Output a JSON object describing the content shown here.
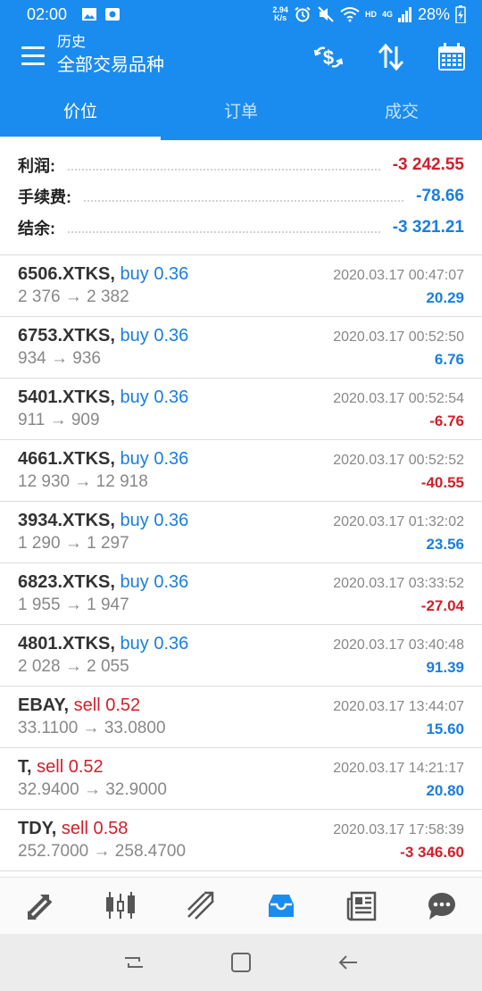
{
  "status": {
    "time": "02:00",
    "speed_top": "2.94",
    "speed_bottom": "K/s",
    "hd": "HD",
    "net": "4G",
    "battery": "28%"
  },
  "header": {
    "subtitle": "历史",
    "title": "全部交易品种"
  },
  "tabs": [
    {
      "label": "价位"
    },
    {
      "label": "订单"
    },
    {
      "label": "成交"
    }
  ],
  "summary": {
    "profit_label": "利润:",
    "profit_value": "-3 242.55",
    "fee_label": "手续费:",
    "fee_value": "-78.66",
    "balance_label": "结余:",
    "balance_value": "-3 321.21"
  },
  "trades": [
    {
      "symbol": "6506.XTKS,",
      "side": "buy 0.36",
      "prices": "2 376 → 2 382",
      "date": "2020.03.17 00:47:07",
      "profit": "20.29"
    },
    {
      "symbol": "6753.XTKS,",
      "side": "buy 0.36",
      "prices": "934 → 936",
      "date": "2020.03.17 00:52:50",
      "profit": "6.76"
    },
    {
      "symbol": "5401.XTKS,",
      "side": "buy 0.36",
      "prices": "911 → 909",
      "date": "2020.03.17 00:52:54",
      "profit": "-6.76"
    },
    {
      "symbol": "4661.XTKS,",
      "side": "buy 0.36",
      "prices": "12 930 → 12 918",
      "date": "2020.03.17 00:52:52",
      "profit": "-40.55"
    },
    {
      "symbol": "3934.XTKS,",
      "side": "buy 0.36",
      "prices": "1 290 → 1 297",
      "date": "2020.03.17 01:32:02",
      "profit": "23.56"
    },
    {
      "symbol": "6823.XTKS,",
      "side": "buy 0.36",
      "prices": "1 955 → 1 947",
      "date": "2020.03.17 03:33:52",
      "profit": "-27.04"
    },
    {
      "symbol": "4801.XTKS,",
      "side": "buy 0.36",
      "prices": "2 028 → 2 055",
      "date": "2020.03.17 03:40:48",
      "profit": "91.39"
    },
    {
      "symbol": "EBAY,",
      "side": "sell 0.52",
      "prices": "33.1100 → 33.0800",
      "date": "2020.03.17 13:44:07",
      "profit": "15.60"
    },
    {
      "symbol": "T,",
      "side": "sell 0.52",
      "prices": "32.9400 → 32.9000",
      "date": "2020.03.17 14:21:17",
      "profit": "20.80"
    },
    {
      "symbol": "TDY,",
      "side": "sell 0.58",
      "prices": "252.7000 → 258.4700",
      "date": "2020.03.17 17:58:39",
      "profit": "-3 346.60"
    }
  ],
  "colors": {
    "brand": "#1a8cf0",
    "buy": "#1a7ee0",
    "sell": "#d0202a",
    "positive": "#1a7ee0",
    "negative": "#d0202a"
  },
  "icons": {
    "appbar": [
      "currency-exchange-icon",
      "sort-icon",
      "calendar-icon"
    ],
    "bottom_nav": [
      "quotes-icon",
      "chart-icon",
      "trade-icon",
      "history-icon",
      "news-icon",
      "chat-icon"
    ],
    "active_nav": "history-icon",
    "system_nav": [
      "recent-apps-icon",
      "home-icon",
      "back-icon"
    ]
  }
}
